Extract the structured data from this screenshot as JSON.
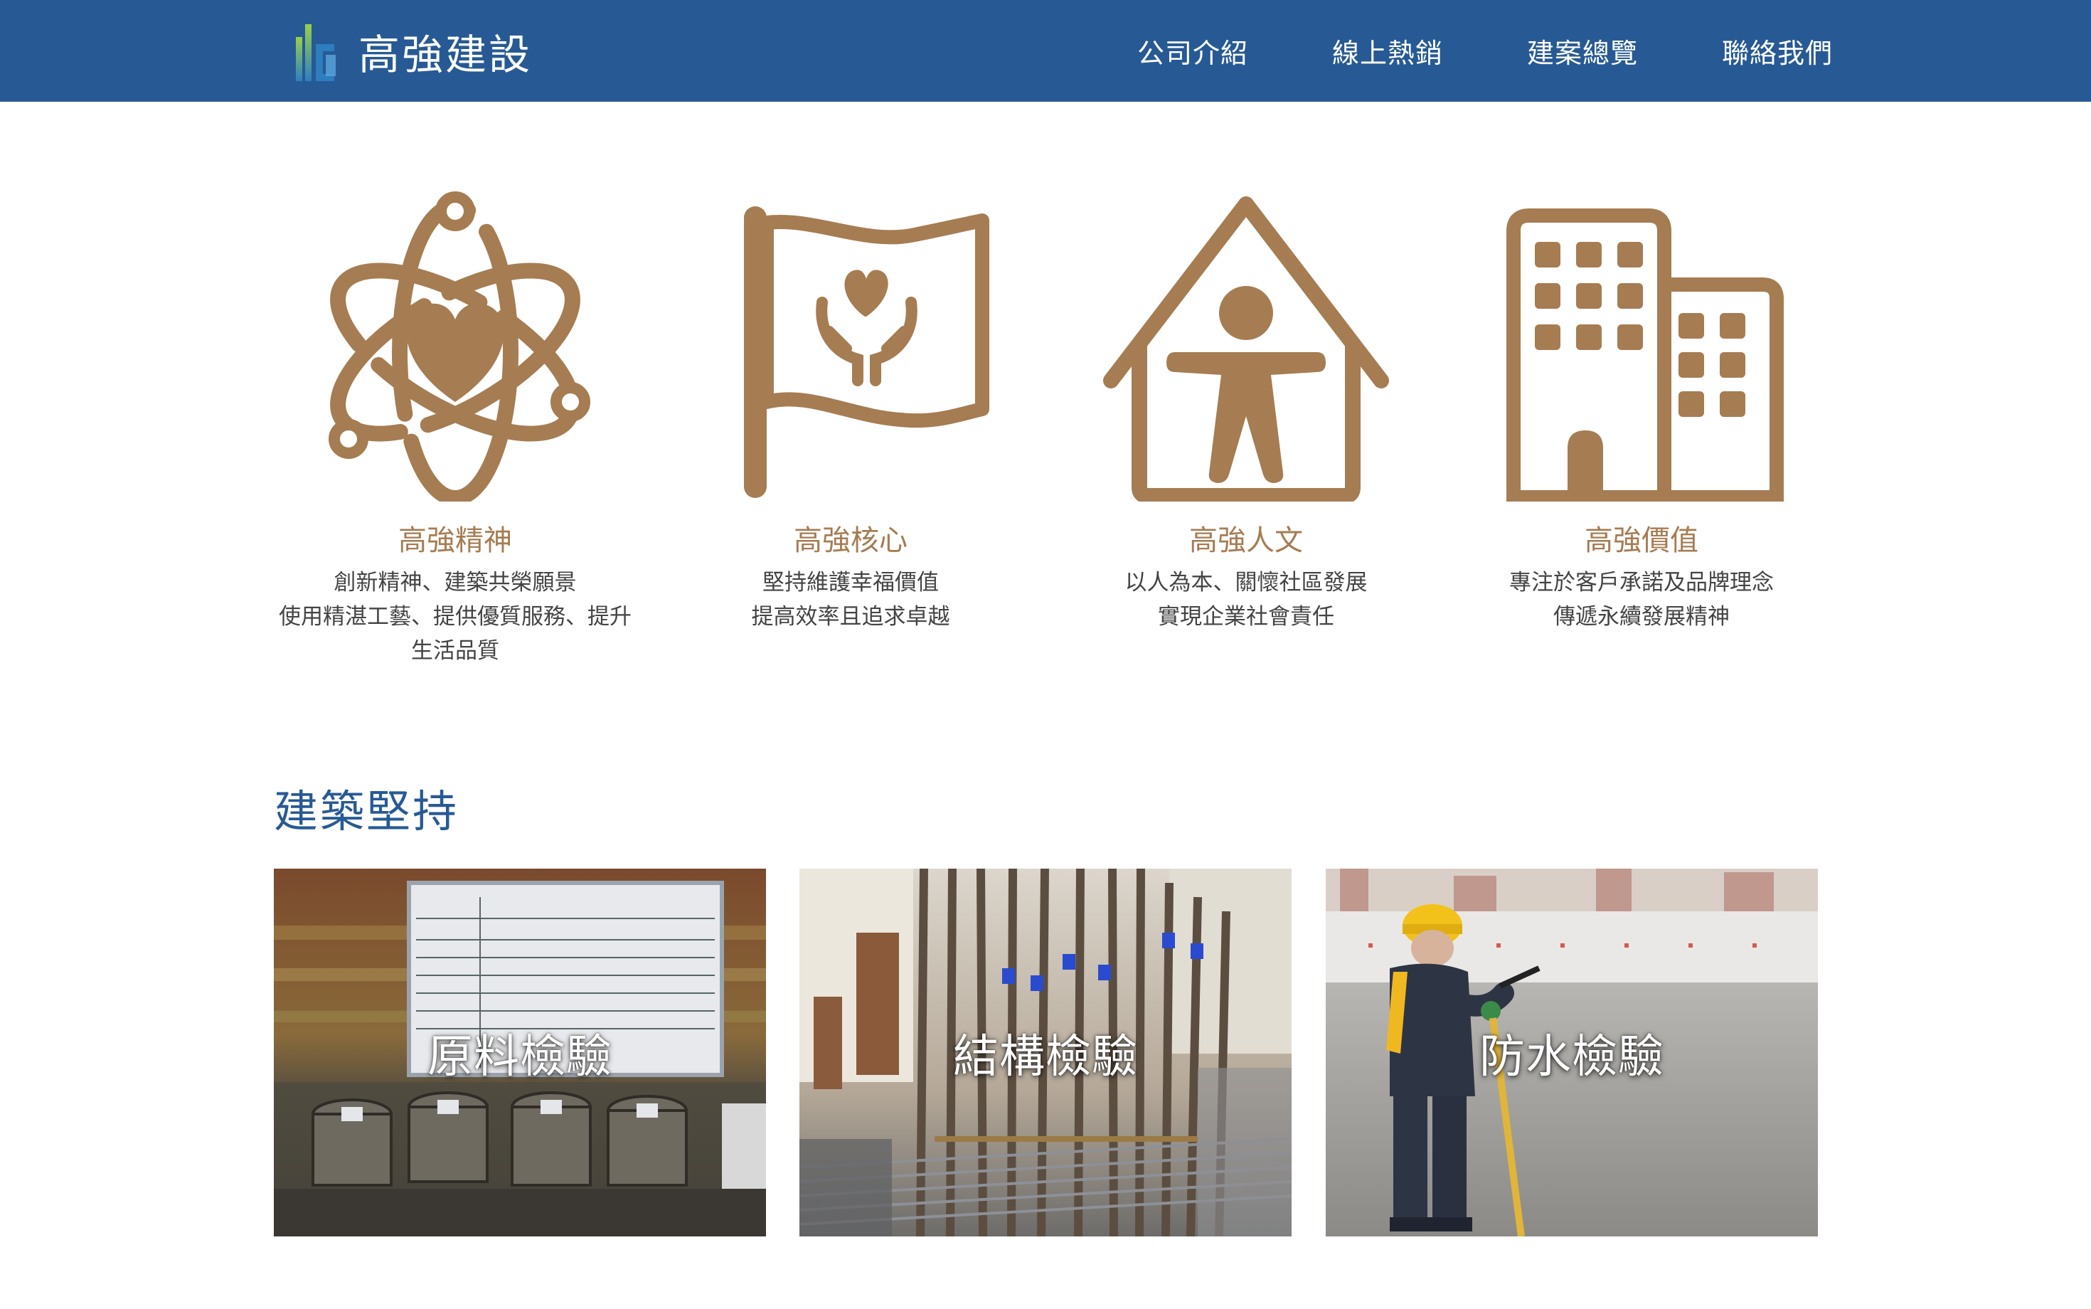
{
  "header": {
    "brand": "高強建設",
    "nav": [
      {
        "label": "公司介紹"
      },
      {
        "label": "線上熱銷"
      },
      {
        "label": "建案總覽"
      },
      {
        "label": "聯絡我們"
      }
    ]
  },
  "colors": {
    "header_bg": "#275a94",
    "accent_brown": "#a67c52",
    "section_title": "#275a94"
  },
  "features": [
    {
      "icon": "atom-heart-icon",
      "title": "高強精神",
      "desc": "創新精神、建築共榮願景\n使用精湛工藝、提供優質服務、提升生活品質"
    },
    {
      "icon": "flag-care-icon",
      "title": "高強核心",
      "desc": "堅持維護幸福價值\n提高效率且追求卓越"
    },
    {
      "icon": "house-person-icon",
      "title": "高強人文",
      "desc": "以人為本、關懷社區發展\n實現企業社會責任"
    },
    {
      "icon": "buildings-icon",
      "title": "高強價值",
      "desc": "專注於客戶承諾及品牌理念\n傳遞永續發展精神"
    }
  ],
  "section": {
    "title": "建築堅持",
    "cards": [
      {
        "label": "原料檢驗"
      },
      {
        "label": "結構檢驗"
      },
      {
        "label": "防水檢驗"
      }
    ]
  }
}
